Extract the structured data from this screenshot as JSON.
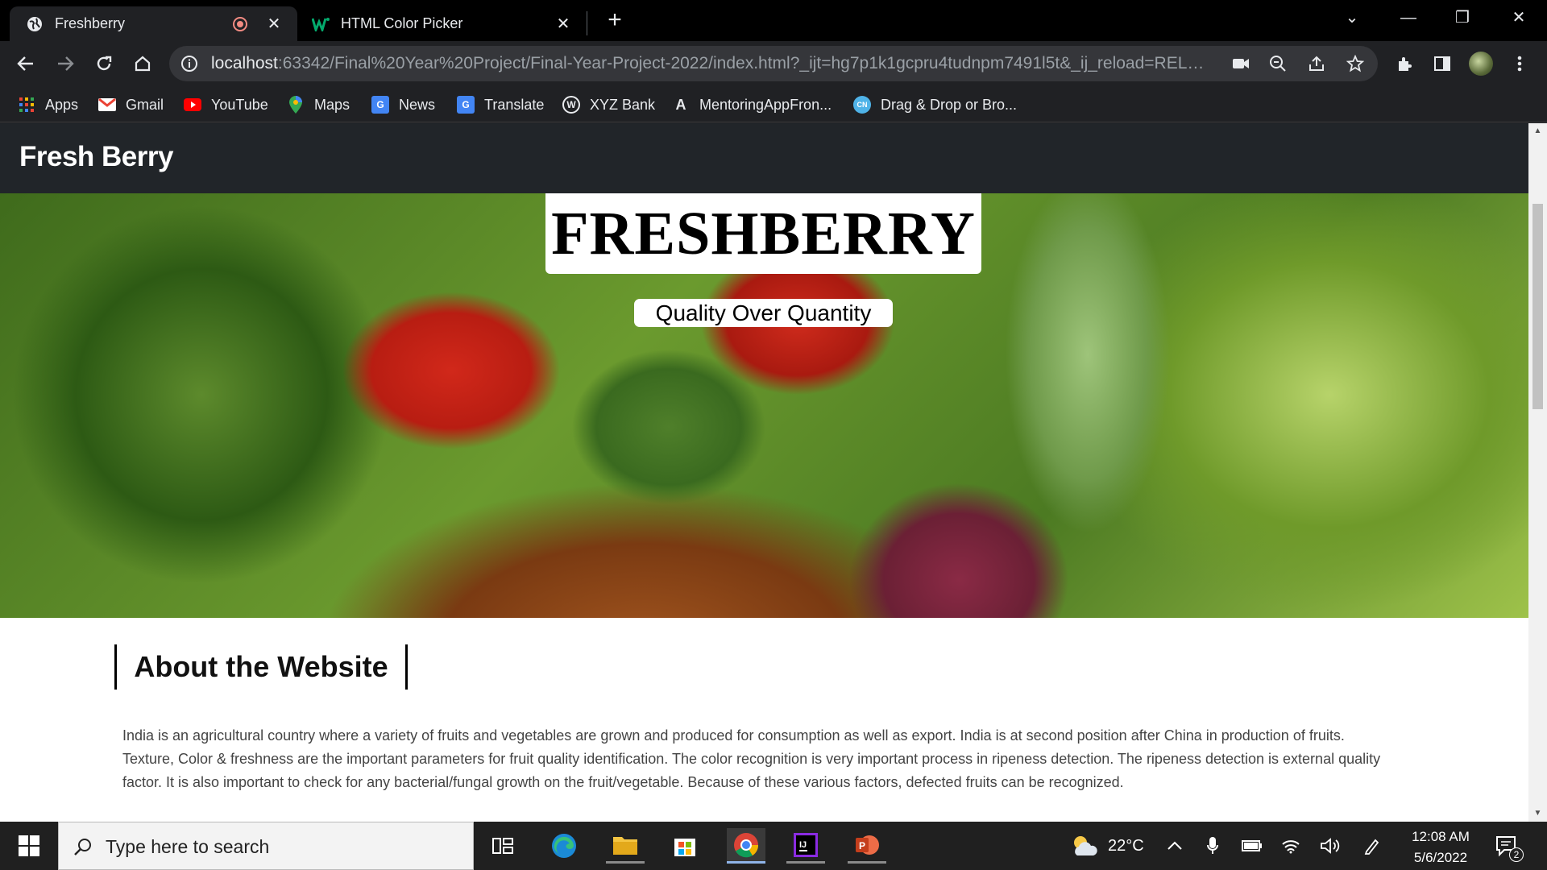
{
  "browser": {
    "tabs": [
      {
        "title": "Freshberry",
        "active": true
      },
      {
        "title": "HTML Color Picker",
        "active": false
      }
    ],
    "new_tab_label": "+",
    "url_host": "localhost",
    "url_rest": ":63342/Final%20Year%20Project/Final-Year-Project-2022/index.html?_ijt=hg7p1k1gcpru4tudnpm7491l5t&_ij_reload=RELOA...",
    "bookmarks": [
      {
        "label": "Apps",
        "icon": "apps-grid-icon"
      },
      {
        "label": "Gmail",
        "icon": "gmail-icon"
      },
      {
        "label": "YouTube",
        "icon": "youtube-icon"
      },
      {
        "label": "Maps",
        "icon": "maps-icon"
      },
      {
        "label": "News",
        "icon": "news-icon"
      },
      {
        "label": "Translate",
        "icon": "translate-icon"
      },
      {
        "label": "XYZ Bank",
        "icon": "wordpress-icon"
      },
      {
        "label": "MentoringAppFron...",
        "icon": "angular-icon"
      },
      {
        "label": "Drag & Drop or Bro...",
        "icon": "cn-icon"
      }
    ]
  },
  "page": {
    "brand": "Fresh Berry",
    "hero_title": "FRESHBERRY",
    "hero_subtitle": "Quality Over Quantity",
    "about_title": "About the Website",
    "about_text": "India is an agricultural country where a variety of fruits and vegetables are grown and produced for consumption as well as export. India is at second position after China in production of fruits. Texture, Color & freshness are the important parameters for fruit quality identification. The color recognition is very important process in ripeness detection. The ripeness detection is external quality factor. It is also important to check for any bacterial/fungal growth on the fruit/vegetable. Because of these various factors, defected fruits can be recognized."
  },
  "taskbar": {
    "search_placeholder": "Type here to search",
    "weather": "22°C",
    "time": "12:08 AM",
    "date": "5/6/2022",
    "notification_count": "2"
  },
  "colors": {
    "navbar": "#212529",
    "chrome_dark": "#202124",
    "taskbar": "#202020"
  }
}
